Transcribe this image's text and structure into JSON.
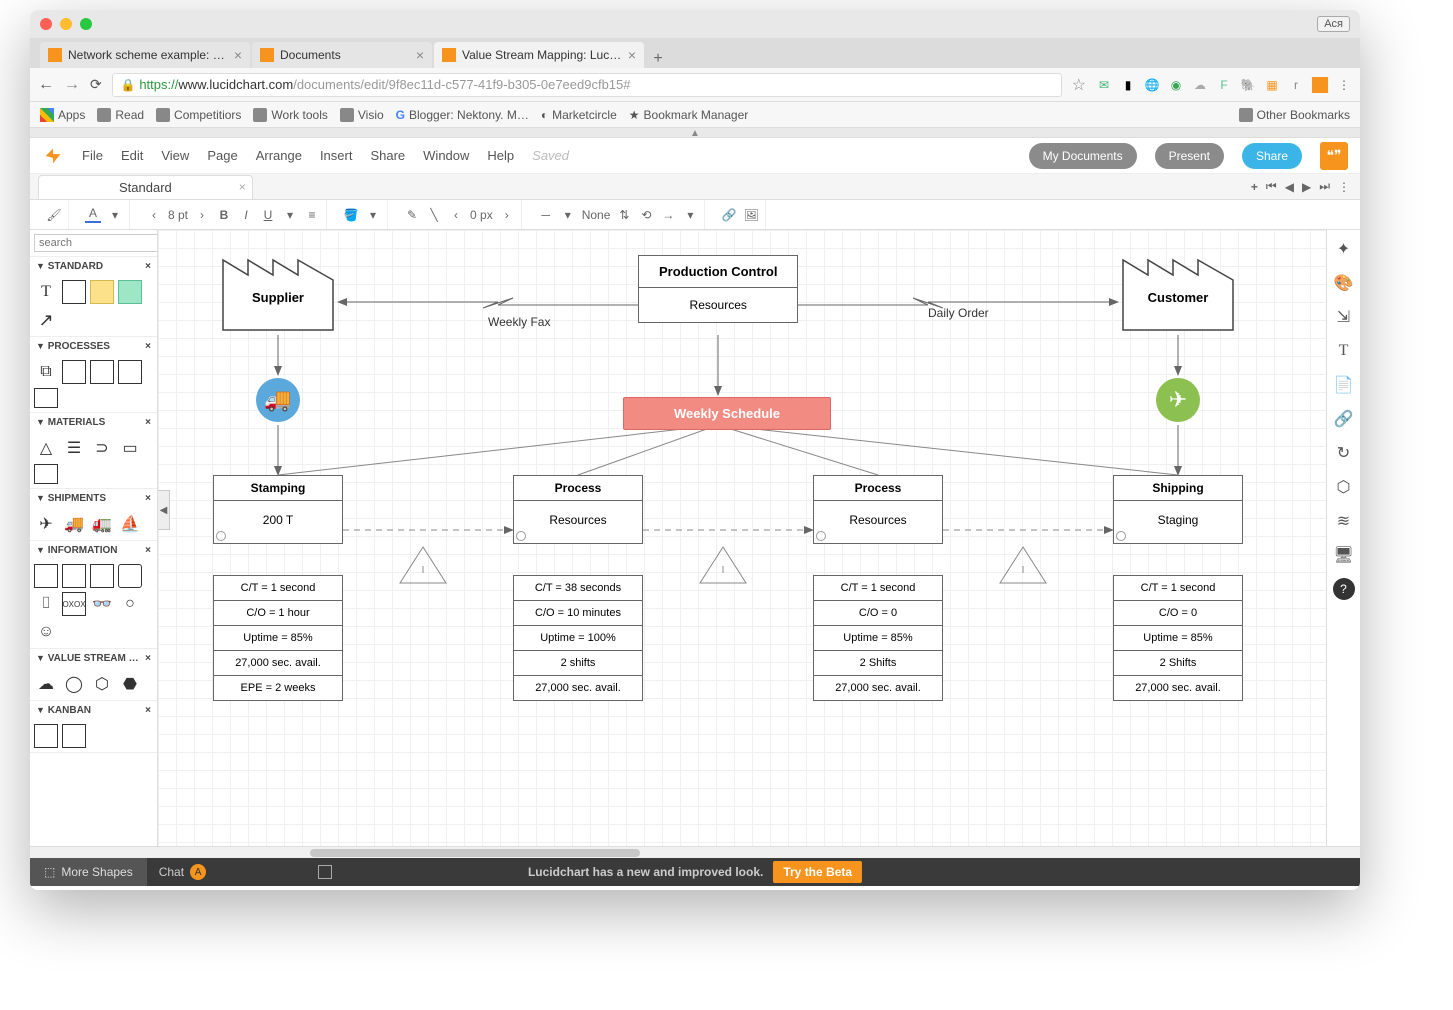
{
  "os": {
    "user": "Ася"
  },
  "browser": {
    "tabs": [
      {
        "title": "Network scheme example: Luc"
      },
      {
        "title": "Documents"
      },
      {
        "title": "Value Stream Mapping: Lucidc"
      }
    ],
    "url": {
      "scheme": "https://",
      "host": "www.lucidchart.com",
      "path": "/documents/edit/9f8ec11d-c577-41f9-b305-0e7eed9cfb15#"
    },
    "bookmarks": [
      "Apps",
      "Read",
      "Competitiors",
      "Work tools",
      "Visio",
      "Blogger: Nektony. M…",
      "Marketcircle",
      "Bookmark Manager"
    ],
    "other_bookmarks": "Other Bookmarks"
  },
  "app": {
    "menus": [
      "File",
      "Edit",
      "View",
      "Page",
      "Arrange",
      "Insert",
      "Share",
      "Window",
      "Help"
    ],
    "saved": "Saved",
    "buttons": {
      "docs": "My Documents",
      "present": "Present",
      "share": "Share"
    },
    "doc_tab": "Standard",
    "format": {
      "font_size": "8 pt",
      "border_px": "0 px",
      "line_style": "None"
    },
    "search_placeholder": "search"
  },
  "shape_groups": {
    "standard": "STANDARD",
    "processes": "PROCESSES",
    "materials": "MATERIALS",
    "shipments": "SHIPMENTS",
    "information": "INFORMATION",
    "value_stream": "VALUE STREAM …",
    "kanban": "KANBAN"
  },
  "diagram": {
    "supplier": "Supplier",
    "customer": "Customer",
    "prodctl": {
      "title": "Production Control",
      "sub": "Resources"
    },
    "weekly_fax": "Weekly Fax",
    "daily_order": "Daily Order",
    "schedule": "Weekly Schedule",
    "p1": {
      "name": "Stamping",
      "res": "200 T"
    },
    "p2": {
      "name": "Process",
      "res": "Resources"
    },
    "p3": {
      "name": "Process",
      "res": "Resources"
    },
    "p4": {
      "name": "Shipping",
      "res": "Staging"
    },
    "d1": [
      "C/T = 1 second",
      "C/O = 1 hour",
      "Uptime = 85%",
      "27,000 sec. avail.",
      "EPE = 2 weeks"
    ],
    "d2": [
      "C/T = 38 seconds",
      "C/O = 10 minutes",
      "Uptime = 100%",
      "2 shifts",
      "27,000 sec. avail."
    ],
    "d3": [
      "C/T = 1 second",
      "C/O = 0",
      "Uptime = 85%",
      "2 Shifts",
      "27,000 sec. avail."
    ],
    "d4": [
      "C/T = 1 second",
      "C/O = 0",
      "Uptime = 85%",
      "2 Shifts",
      "27,000 sec. avail."
    ]
  },
  "bottom": {
    "more_shapes": "More Shapes",
    "chat": "Chat",
    "chat_initial": "A",
    "promo": "Lucidchart has a new and improved look.",
    "beta": "Try the Beta"
  }
}
